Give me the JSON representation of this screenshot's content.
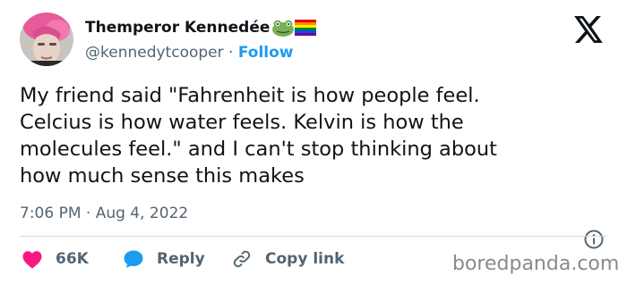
{
  "author": {
    "display_name": "Themperor Kennedée",
    "handle": "@kennedytcooper",
    "separator": "·",
    "follow_label": "Follow",
    "name_emojis": [
      "frog-icon",
      "rainbow-flag-icon"
    ]
  },
  "tweet": {
    "text": "My friend said \"Fahrenheit is how people feel.\nCelcius is how water feels. Kelvin is how the\nmolecules feel.\" and I can't stop thinking about\nhow much sense this makes",
    "timestamp": "7:06 PM · Aug 4, 2022"
  },
  "actions": {
    "like_count": "66K",
    "reply_label": "Reply",
    "copy_link_label": "Copy link"
  },
  "watermark": "boredpanda.com",
  "colors": {
    "accent": "#1d9bf0",
    "like": "#f91880",
    "text": "#0f1419",
    "muted": "#536471"
  }
}
